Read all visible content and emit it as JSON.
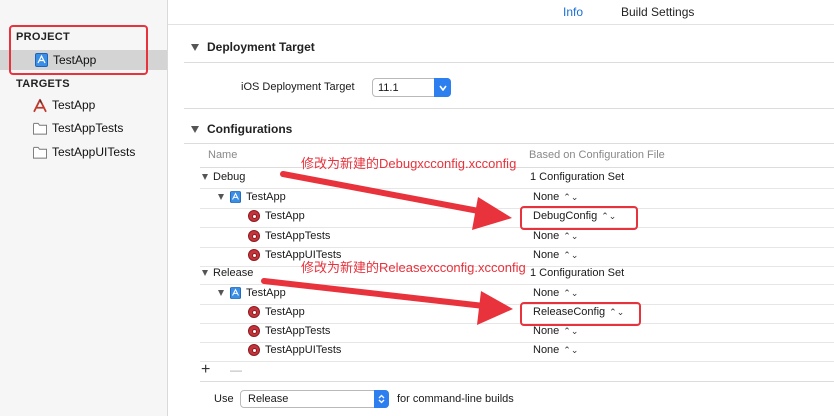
{
  "topbar": {
    "tabs": [
      {
        "label": "Info",
        "active": true
      },
      {
        "label": "Build Settings",
        "active": false
      }
    ]
  },
  "sidebar": {
    "project_header": "PROJECT",
    "project_item": "TestApp",
    "targets_header": "TARGETS",
    "targets": [
      "TestApp",
      "TestAppTests",
      "TestAppUITests"
    ]
  },
  "deployment": {
    "title": "Deployment Target",
    "label": "iOS Deployment Target",
    "value": "11.1"
  },
  "configurations": {
    "title": "Configurations",
    "col_name": "Name",
    "col_file": "Based on Configuration File",
    "debug": {
      "name": "Debug",
      "summary": "1 Configuration Set",
      "project": "TestApp",
      "project_value": "None",
      "targets": [
        {
          "name": "TestApp",
          "value": "DebugConfig"
        },
        {
          "name": "TestAppTests",
          "value": "None"
        },
        {
          "name": "TestAppUITests",
          "value": "None"
        }
      ]
    },
    "release": {
      "name": "Release",
      "summary": "1 Configuration Set",
      "project": "TestApp",
      "project_value": "None",
      "targets": [
        {
          "name": "TestApp",
          "value": "ReleaseConfig"
        },
        {
          "name": "TestAppTests",
          "value": "None"
        },
        {
          "name": "TestAppUITests",
          "value": "None"
        }
      ]
    },
    "add_symbol": "+",
    "remove_symbol": "—"
  },
  "cmdline": {
    "use_label": "Use",
    "value": "Release",
    "suffix": "for command-line builds"
  },
  "annotations": {
    "debug_note": "修改为新建的Debugxcconfig.xcconfig",
    "release_note": "修改为新建的Releasexcconfig.xcconfig"
  },
  "colors": {
    "annotation_red": "#e8323c",
    "accent_blue": "#1a6fd6"
  },
  "icons": [
    "sidebar-toggle-icon",
    "xcode-project-icon",
    "app-target-icon",
    "folder-icon",
    "target-icon",
    "popup-arrows-icon"
  ]
}
